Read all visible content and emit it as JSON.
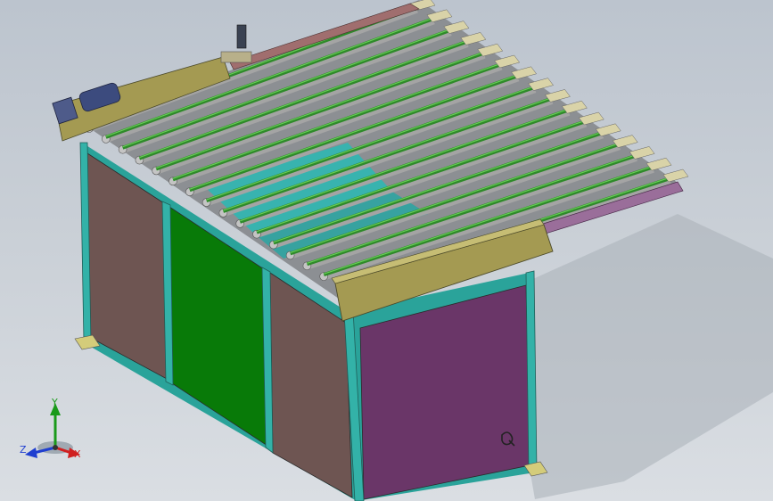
{
  "viewport": {
    "background_top": "#bcc4ce",
    "background_bottom": "#dadee3"
  },
  "colors": {
    "frame": "#2aa39a",
    "panel_brown": "#6e5552",
    "panel_green": "#087a08",
    "panel_purple": "#6a3668",
    "belt": "#2f8a2a",
    "belt_highlight": "#66cc55",
    "roller": "#a4a4a4",
    "cyan_panel": "#2fb7b2",
    "olive_beam": "#a49a52",
    "tan_block": "#d9d3a8",
    "motor": "#3c4b7e",
    "mauve_bar": "#9a6e9a"
  },
  "model": {
    "roller_count": 16
  },
  "triad": {
    "y_label": "Y",
    "z_label": "Z",
    "x_label": "X",
    "icon": "coordinate-triad-icon"
  }
}
